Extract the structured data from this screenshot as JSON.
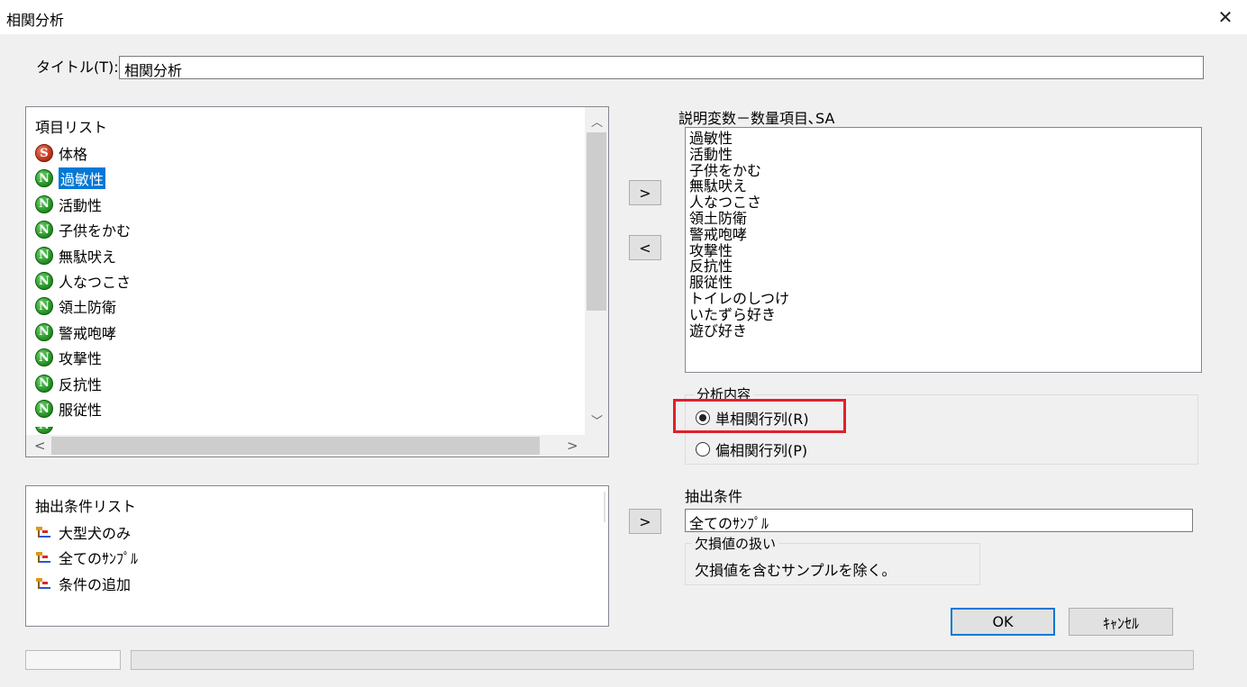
{
  "window": {
    "title": "相関分析",
    "close_glyph": "✕"
  },
  "title_field": {
    "label": "タイトル(T):",
    "value": "相関分析"
  },
  "item_list": {
    "header": "項目リスト",
    "items": [
      {
        "label": "体格",
        "icon": "S"
      },
      {
        "label": "過敏性",
        "icon": "N",
        "selected": true
      },
      {
        "label": "活動性",
        "icon": "N"
      },
      {
        "label": "子供をかむ",
        "icon": "N"
      },
      {
        "label": "無駄吠え",
        "icon": "N"
      },
      {
        "label": "人なつこさ",
        "icon": "N"
      },
      {
        "label": "領土防衛",
        "icon": "N"
      },
      {
        "label": "警戒咆哮",
        "icon": "N"
      },
      {
        "label": "攻撃性",
        "icon": "N"
      },
      {
        "label": "反抗性",
        "icon": "N"
      },
      {
        "label": "服従性",
        "icon": "N"
      }
    ]
  },
  "buttons": {
    "add": ">",
    "remove": "<",
    "add_condition": ">",
    "ok": "OK",
    "cancel": "ｷｬﾝｾﾙ"
  },
  "explanatory": {
    "label": "説明変数－数量項目､SA",
    "items": [
      "過敏性",
      "活動性",
      "子供をかむ",
      "無駄吠え",
      "人なつこさ",
      "領土防衛",
      "警戒咆哮",
      "攻撃性",
      "反抗性",
      "服従性",
      "トイレのしつけ",
      "いたずら好き",
      "遊び好き"
    ]
  },
  "analysis": {
    "group_label": "分析内容",
    "options": [
      {
        "label": "単相関行列(R)",
        "checked": true
      },
      {
        "label": "偏相関行列(P)",
        "checked": false
      }
    ],
    "highlight_color": "#e0202a"
  },
  "condition_list": {
    "header": "抽出条件リスト",
    "items": [
      "大型犬のみ",
      "全てのｻﾝﾌﾟﾙ",
      "条件の追加"
    ]
  },
  "extraction": {
    "label": "抽出条件",
    "value": "全てのｻﾝﾌﾟﾙ"
  },
  "missing": {
    "group_label": "欠損値の扱い",
    "text": "欠損値を含むサンプルを除く。"
  },
  "colors": {
    "selection": "#0078d7",
    "ok_border": "#0078d7"
  }
}
